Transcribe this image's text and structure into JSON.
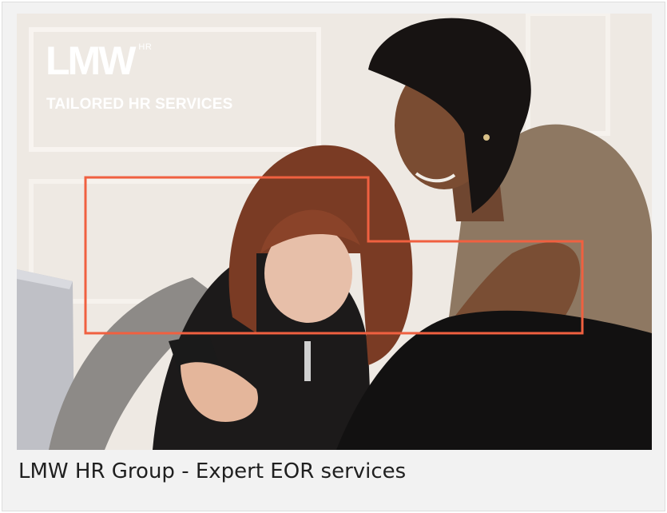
{
  "hero": {
    "logo_text": "LMW",
    "logo_superscript": "HR",
    "tagline": "TAILORED HR SERVICES",
    "frame_color": "#f06040"
  },
  "caption": "LMW HR Group - Expert EOR services"
}
